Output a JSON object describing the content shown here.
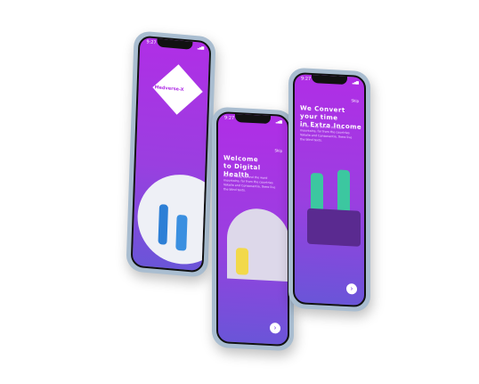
{
  "status_time": "9:27",
  "phones": [
    {
      "logo_text": "Medverse-X"
    },
    {
      "skip": "Skip",
      "title_line1": "Welcome",
      "title_line2": "to Digital Health",
      "body": "Far far away, behind the word mountains, far from the countries Vokalia and Consonantia, there live the blind texts.",
      "next": "›"
    },
    {
      "skip": "Skip",
      "title_line1": "We Convert your time",
      "title_line2": "in Extra Income",
      "body": "Far far away, behind the word mountains, far from the countries Vokalia and Consonantia, there live the blind texts.",
      "next": "›"
    }
  ]
}
